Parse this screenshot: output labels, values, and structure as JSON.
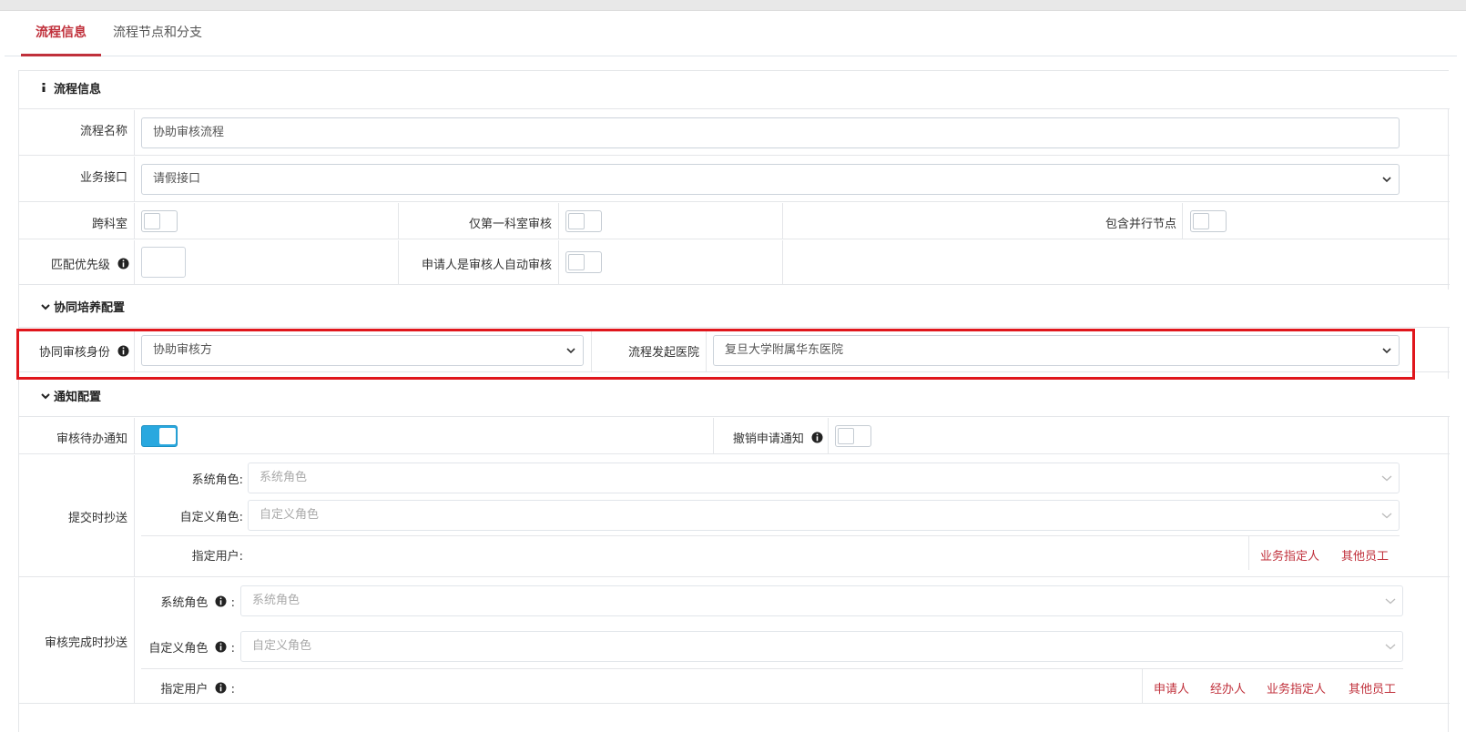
{
  "tabs": [
    {
      "label": "流程信息",
      "active": true
    },
    {
      "label": "流程节点和分支",
      "active": false
    }
  ],
  "flow_info": {
    "section_title": "流程信息",
    "name_label": "流程名称",
    "name_value": "协助审核流程",
    "interface_label": "业务接口",
    "interface_value": "请假接口",
    "cross_dept_label": "跨科室",
    "first_dept_only_label": "仅第一科室审核",
    "parallel_node_label": "包含并行节点",
    "match_priority_label": "匹配优先级",
    "applicant_auto_label": "申请人是审核人自动审核"
  },
  "collab": {
    "section_title": "协同培养配置",
    "identity_label": "协同审核身份",
    "identity_value": "协助审核方",
    "hospital_label": "流程发起医院",
    "hospital_value": "复旦大学附属华东医院"
  },
  "notify": {
    "section_title": "通知配置",
    "pending_label": "审核待办通知",
    "pending_on": true,
    "revoke_label": "撤销申请通知",
    "revoke_on": false,
    "submit_cc_label": "提交时抄送",
    "submit_sys_role_label": "系统角色:",
    "submit_sys_role_placeholder": "系统角色",
    "submit_custom_role_label": "自定义角色:",
    "submit_custom_role_placeholder": "自定义角色",
    "submit_user_label": "指定用户:",
    "submit_links": [
      "业务指定人",
      "其他员工"
    ],
    "done_cc_label": "审核完成时抄送",
    "done_sys_role_label": "系统角色",
    "done_sys_role_placeholder": "系统角色",
    "done_custom_role_label": "自定义角色",
    "done_custom_role_placeholder": "自定义角色",
    "done_user_label": "指定用户",
    "colon": ":",
    "done_links": [
      "申请人",
      "经办人",
      "业务指定人",
      "其他员工"
    ]
  },
  "colors": {
    "accent": "#c0303b",
    "toggle_on": "#29a8df",
    "highlight": "#e0161c"
  }
}
